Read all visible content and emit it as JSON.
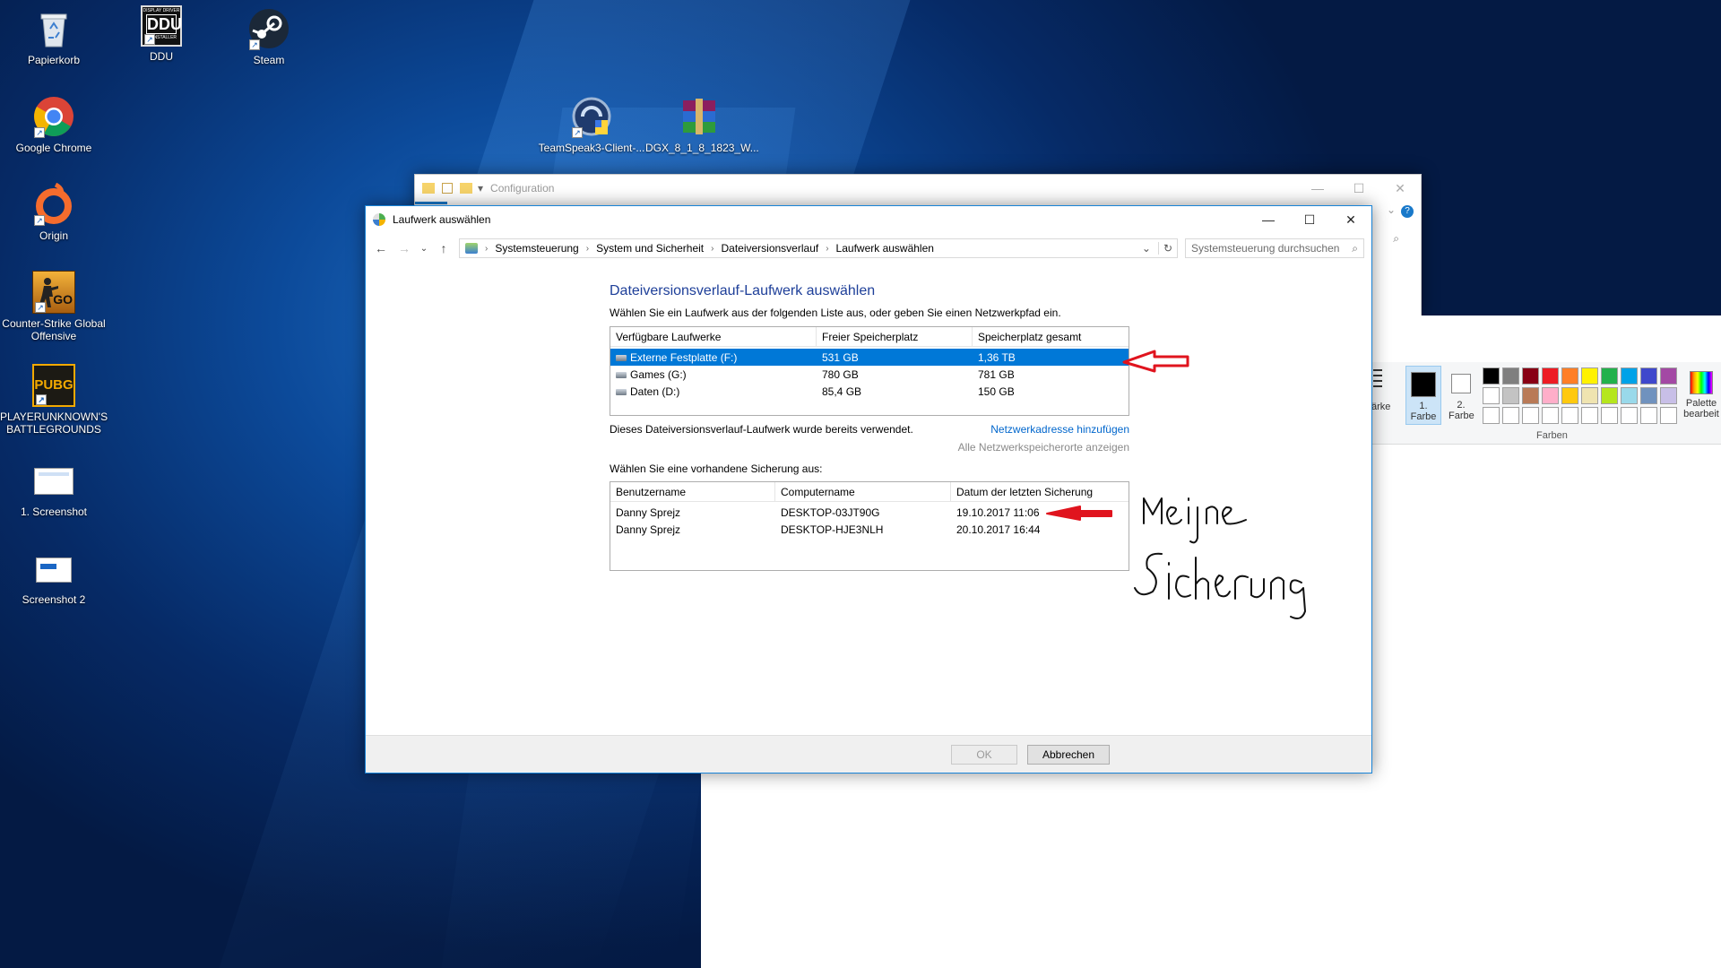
{
  "desktop": {
    "icons": [
      {
        "label": "Papierkorb",
        "icon": "recycle-bin-icon"
      },
      {
        "label": "DDU",
        "icon": "ddu-icon"
      },
      {
        "label": "Steam",
        "icon": "steam-icon"
      },
      {
        "label": "Google Chrome",
        "icon": "chrome-icon"
      },
      {
        "label": "Origin",
        "icon": "origin-icon"
      },
      {
        "label": "Counter-Strike Global Offensive",
        "icon": "csgo-icon"
      },
      {
        "label": "PLAYERUNKNOWN'S BATTLEGROUNDS",
        "icon": "pubg-icon"
      },
      {
        "label": "1. Screenshot",
        "icon": "image-file-icon"
      },
      {
        "label": "Screenshot 2",
        "icon": "image-file-icon"
      },
      {
        "label": "TeamSpeak3-Client-...",
        "icon": "teamspeak-icon"
      },
      {
        "label": "DGX_8_1_8_1823_W...",
        "icon": "winrar-archive-icon"
      }
    ],
    "ddu_badge_top": "DISPLAY DRIVER",
    "ddu_badge_main": "DDU",
    "ddu_badge_bottom": "UNINSTALLER",
    "csgo_badge": "GO",
    "pubg_badge": "PUBG"
  },
  "explorer_back": {
    "title": "Configuration"
  },
  "paint": {
    "size_label": "ärke",
    "color1_label": "1. Farbe",
    "color2_label": "2. Farbe",
    "colors_group_label": "Farben",
    "edit_palette_label": "Palette bearbeit",
    "colors": {
      "color1": "#000000",
      "color2": "#ffffff",
      "row1": [
        "#000000",
        "#7f7f7f",
        "#880015",
        "#ed1c24",
        "#ff7f27",
        "#fff200",
        "#22b14c",
        "#00a2e8",
        "#3f48cc",
        "#a349a4"
      ],
      "row2": [
        "#ffffff",
        "#c3c3c3",
        "#b97a57",
        "#ffaec9",
        "#ffc90e",
        "#efe4b0",
        "#b5e61d",
        "#99d9ea",
        "#7092be",
        "#c8bfe7"
      ],
      "row3": [
        "#ffffff",
        "#ffffff",
        "#ffffff",
        "#ffffff",
        "#ffffff",
        "#ffffff",
        "#ffffff",
        "#ffffff",
        "#ffffff",
        "#ffffff"
      ]
    }
  },
  "dialog": {
    "title": "Laufwerk auswählen",
    "breadcrumbs": [
      "Systemsteuerung",
      "System und Sicherheit",
      "Dateiversionsverlauf",
      "Laufwerk auswählen"
    ],
    "search_placeholder": "Systemsteuerung durchsuchen",
    "heading": "Dateiversionsverlauf-Laufwerk auswählen",
    "instruction": "Wählen Sie ein Laufwerk aus der folgenden Liste aus, oder geben Sie einen Netzwerkpfad ein.",
    "drives_columns": [
      "Verfügbare Laufwerke",
      "Freier Speicherplatz",
      "Speicherplatz gesamt"
    ],
    "drives": [
      {
        "name": "Externe Festplatte (F:)",
        "free": "531 GB",
        "total": "1,36 TB",
        "selected": true
      },
      {
        "name": "Games (G:)",
        "free": "780 GB",
        "total": "781 GB",
        "selected": false
      },
      {
        "name": "Daten (D:)",
        "free": "85,4 GB",
        "total": "150 GB",
        "selected": false
      }
    ],
    "already_used_note": "Dieses Dateiversionsverlauf-Laufwerk wurde bereits verwendet.",
    "add_network_link": "Netzwerkadresse hinzufügen",
    "show_network_link": "Alle Netzwerkspeicherorte anzeigen",
    "backup_prompt": "Wählen Sie eine vorhandene Sicherung aus:",
    "backup_columns": [
      "Benutzername",
      "Computername",
      "Datum der letzten Sicherung"
    ],
    "backups": [
      {
        "user": "Danny Sprejz",
        "computer": "DESKTOP-03JT90G",
        "date": "19.10.2017 11:06"
      },
      {
        "user": "Danny Sprejz",
        "computer": "DESKTOP-HJE3NLH",
        "date": "20.10.2017 16:44"
      }
    ],
    "ok_label": "OK",
    "cancel_label": "Abbrechen"
  },
  "annotation": {
    "line1": "Meine",
    "line2": "Sicherung",
    "arrow_color": "#e0141e"
  }
}
